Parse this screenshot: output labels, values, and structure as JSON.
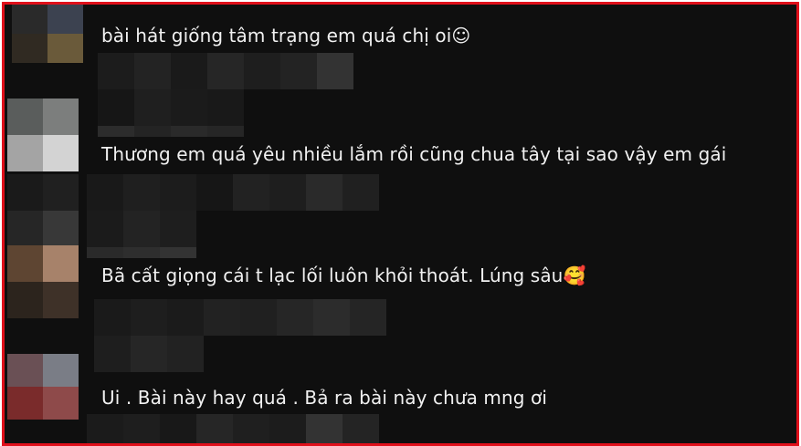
{
  "comments": [
    {
      "text": "bài hát giống tâm trạng em quá chị oi",
      "emoji": "☺"
    },
    {
      "text": "Thương em quá yêu nhiều lắm rồi cũng chua tây tại sao vậy em gái",
      "emoji": ""
    },
    {
      "text": "Bã cất giọng cái t lạc lối luôn khỏi thoát. Lúng sâu",
      "emoji": "🥰"
    },
    {
      "text": "Ui . Bài này hay quá . Bả ra bài này chưa mng ơi",
      "emoji": ""
    }
  ],
  "colors": {
    "border": "#e0101b",
    "background": "#0f0f0f",
    "text": "#f1f1f1"
  }
}
